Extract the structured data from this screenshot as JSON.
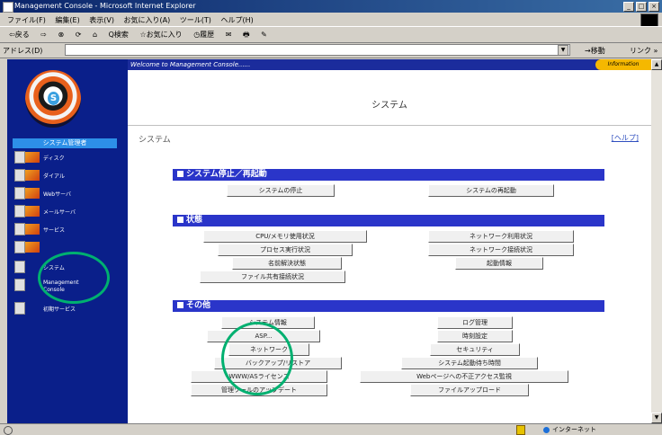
{
  "window": {
    "title": "Management Console - Microsoft Internet Explorer",
    "controls": [
      "_",
      "□",
      "×"
    ]
  },
  "menu": [
    "ファイル(F)",
    "編集(E)",
    "表示(V)",
    "お気に入り(A)",
    "ツール(T)",
    "ヘルプ(H)"
  ],
  "toolbar": [
    "⇦戻る",
    "⇨",
    "⊗",
    "⟳",
    "⌂",
    "Q検索",
    "☆お気に入り",
    "◷履歴",
    "✉",
    "🖶",
    "✎"
  ],
  "address": {
    "label": "アドレス(D)",
    "go": "→移動",
    "links": "リンク »"
  },
  "sidebar": {
    "active": "システム管理者",
    "items": [
      {
        "label": "ディスク"
      },
      {
        "label": "ダイアル"
      },
      {
        "label": "Webサーバ"
      },
      {
        "label": "メールサーバ"
      },
      {
        "label": "サービス"
      },
      {
        "label": ""
      },
      {
        "label": "システム"
      },
      {
        "label": "Management Console"
      },
      {
        "label": "初期サービス"
      }
    ]
  },
  "main": {
    "welcome": "Welcome to Management Console......",
    "info_tab": "Information",
    "page_title": "システム",
    "breadcrumb": "システム",
    "help": "[ヘルプ]",
    "sections": [
      {
        "title": "システム停止／再起動",
        "buttons": [
          "システムの停止",
          "システムの再起動"
        ]
      },
      {
        "title": "状態",
        "buttons": [
          "CPU/メモリ使用状況",
          "ネットワーク利用状況",
          "プロセス実行状況",
          "ネットワーク接続状況",
          "名前解決状態",
          "起動情報",
          "ファイル共有接続状況"
        ]
      },
      {
        "title": "その他",
        "buttons": [
          "システム情報",
          "ログ管理",
          "ASP...",
          "時刻設定",
          "ネットワーク",
          "セキュリティ",
          "バックアップ/リストア",
          "システム起動待ち時間",
          "WWW/ASライセンス",
          "Webページへの不正アクセス監視",
          "管理ツールのアップデート",
          "ファイルアップロード"
        ]
      }
    ]
  },
  "status": {
    "zone": "インターネット"
  }
}
